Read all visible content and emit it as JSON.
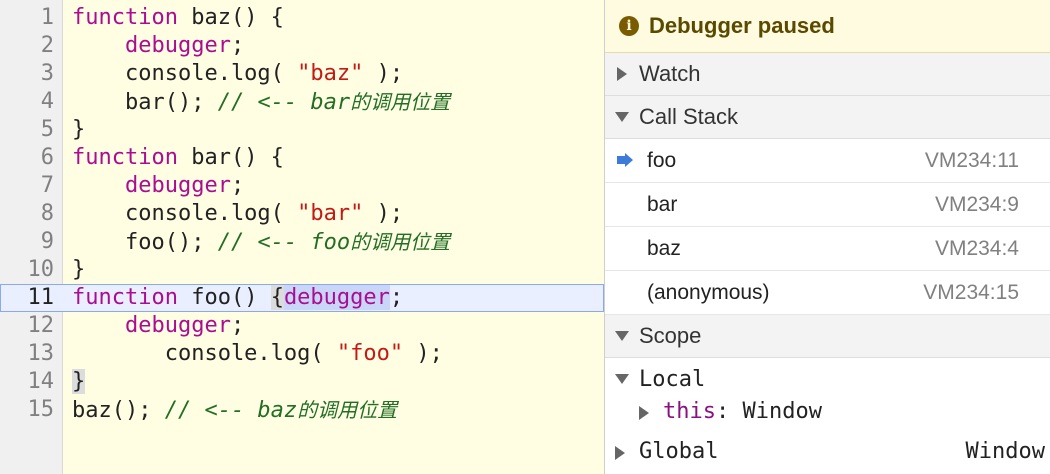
{
  "editor": {
    "lines": [
      {
        "n": "1",
        "tokens": [
          {
            "t": "kw",
            "v": "function"
          },
          {
            "t": "p",
            "v": " baz() {"
          }
        ]
      },
      {
        "n": "2",
        "tokens": [
          {
            "t": "p",
            "v": "    "
          },
          {
            "t": "kw",
            "v": "debugger"
          },
          {
            "t": "p",
            "v": ";"
          }
        ]
      },
      {
        "n": "3",
        "tokens": [
          {
            "t": "p",
            "v": "    console.log( "
          },
          {
            "t": "str",
            "v": "\"baz\""
          },
          {
            "t": "p",
            "v": " );"
          }
        ]
      },
      {
        "n": "4",
        "tokens": [
          {
            "t": "p",
            "v": "    bar(); "
          },
          {
            "t": "cm",
            "v": "// <-- bar"
          },
          {
            "t": "cmcjk",
            "v": "的调用位置"
          }
        ]
      },
      {
        "n": "5",
        "tokens": [
          {
            "t": "p",
            "v": "}"
          }
        ]
      },
      {
        "n": "6",
        "tokens": [
          {
            "t": "kw",
            "v": "function"
          },
          {
            "t": "p",
            "v": " bar() {"
          }
        ]
      },
      {
        "n": "7",
        "tokens": [
          {
            "t": "p",
            "v": "    "
          },
          {
            "t": "kw",
            "v": "debugger"
          },
          {
            "t": "p",
            "v": ";"
          }
        ]
      },
      {
        "n": "8",
        "tokens": [
          {
            "t": "p",
            "v": "    console.log( "
          },
          {
            "t": "str",
            "v": "\"bar\""
          },
          {
            "t": "p",
            "v": " );"
          }
        ]
      },
      {
        "n": "9",
        "tokens": [
          {
            "t": "p",
            "v": "    foo(); "
          },
          {
            "t": "cm",
            "v": "// <-- foo"
          },
          {
            "t": "cmcjk",
            "v": "的调用位置"
          }
        ]
      },
      {
        "n": "10",
        "tokens": [
          {
            "t": "p",
            "v": "}"
          }
        ]
      },
      {
        "n": "11",
        "current": true,
        "tokens": [
          {
            "t": "kw",
            "v": "function"
          },
          {
            "t": "p",
            "v": " foo() "
          },
          {
            "t": "hlbrace",
            "v": "{"
          },
          {
            "t": "hlkw",
            "v": "debugger"
          },
          {
            "t": "p",
            "v": ";"
          }
        ]
      },
      {
        "n": "12",
        "tokens": [
          {
            "t": "p",
            "v": "    "
          },
          {
            "t": "kw",
            "v": "debugger"
          },
          {
            "t": "p",
            "v": ";"
          }
        ]
      },
      {
        "n": "13",
        "tokens": [
          {
            "t": "p",
            "v": "       console.log( "
          },
          {
            "t": "str",
            "v": "\"foo\""
          },
          {
            "t": "p",
            "v": " );"
          }
        ]
      },
      {
        "n": "14",
        "tokens": [
          {
            "t": "hlbrace",
            "v": "}"
          }
        ]
      },
      {
        "n": "15",
        "tokens": [
          {
            "t": "p",
            "v": "baz(); "
          },
          {
            "t": "cm",
            "v": "// <-- baz"
          },
          {
            "t": "cmcjk",
            "v": "的调用位置"
          }
        ]
      }
    ]
  },
  "sidebar": {
    "paused_icon": "info-icon",
    "paused_label": "Debugger paused",
    "watch_label": "Watch",
    "call_stack_label": "Call Stack",
    "call_stack": [
      {
        "name": "foo",
        "location": "VM234:11"
      },
      {
        "name": "bar",
        "location": "VM234:9"
      },
      {
        "name": "baz",
        "location": "VM234:4"
      },
      {
        "name": "(anonymous)",
        "location": "VM234:15"
      }
    ],
    "scope_label": "Scope",
    "local_label": "Local",
    "this_key": "this",
    "this_sep": ": ",
    "this_value": "Window",
    "global_label": "Global",
    "global_value": "Window"
  },
  "colors": {
    "keyword": "#aa0d91",
    "string": "#c41a16",
    "comment": "#236e25",
    "current_line": "#e9efff",
    "frame_arrow": "#3d7bdb"
  }
}
